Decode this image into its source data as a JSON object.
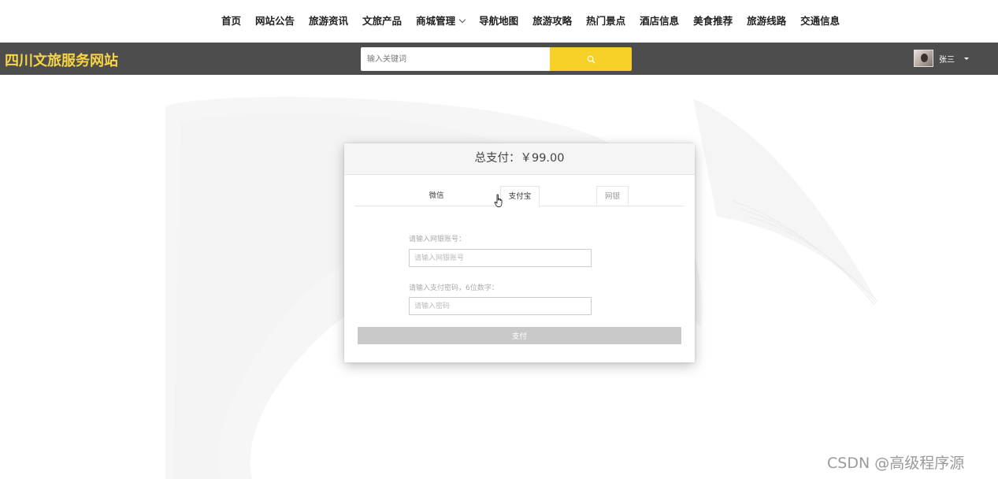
{
  "nav": {
    "items": [
      {
        "label": "首页"
      },
      {
        "label": "网站公告"
      },
      {
        "label": "旅游资讯"
      },
      {
        "label": "文旅产品"
      },
      {
        "label": "商城管理",
        "dropdown": true
      },
      {
        "label": "导航地图"
      },
      {
        "label": "旅游攻略"
      },
      {
        "label": "热门景点"
      },
      {
        "label": "酒店信息"
      },
      {
        "label": "美食推荐"
      },
      {
        "label": "旅游线路"
      },
      {
        "label": "交通信息"
      }
    ]
  },
  "header": {
    "site_title": "四川文旅服务网站",
    "search_placeholder": "输入关键词",
    "username": "张三",
    "bg_color": "#4d4d4d",
    "title_color": "#f7d544",
    "search_button_color": "#f7d027"
  },
  "payment": {
    "total": "总支付：￥99.00",
    "tabs": {
      "wechat": "微信",
      "alipay": "支付宝",
      "bank": "网银"
    },
    "active_tab": "alipay",
    "account_label": "请输入网银账号：",
    "account_placeholder": "请输入网银账号",
    "password_label": "请输入支付密码，6位数字：",
    "password_placeholder": "请输入密码",
    "pay_label": "支付"
  },
  "watermark": "CSDN @高级程序源",
  "icons": {
    "search": "search-icon",
    "caret": "caret-down-icon",
    "cursor": "hand-pointer-icon"
  }
}
